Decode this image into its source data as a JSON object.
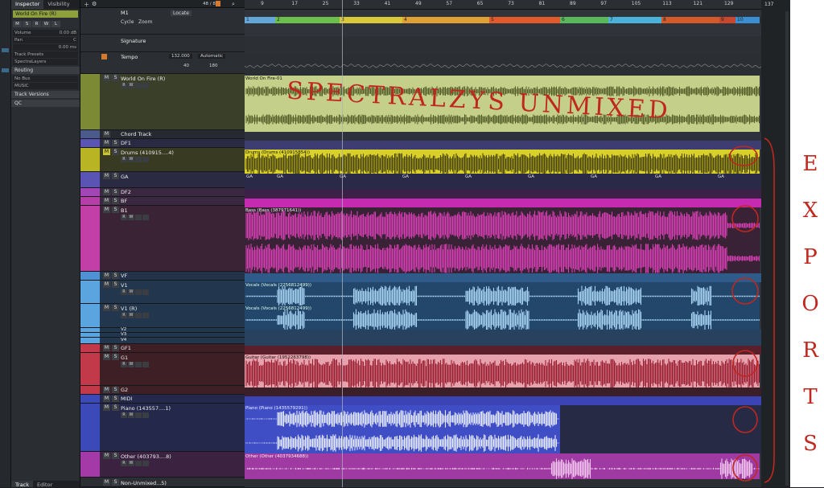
{
  "inspector": {
    "tabs": [
      "Inspector",
      "Visibility"
    ],
    "track_title": "World On Fire (R)",
    "buttons": [
      "M",
      "S",
      "R",
      "W",
      "L"
    ],
    "volume_label": "Volume",
    "volume_value": "0.00 dB",
    "pan_label": "Pan",
    "pan_value": "C",
    "delay_value": "0.00 ms",
    "preset": "Track Presets",
    "spectralayers": "SpectraLayers",
    "routing_label": "Routing",
    "routing_in": "No Bus",
    "routing_out": "MUSIC",
    "track_versions": "Track Versions",
    "qc": "QC",
    "bottom_tabs": [
      "Track",
      "Editor"
    ]
  },
  "tracklist_header": {
    "counter": "48 / 84"
  },
  "tracks": [
    {
      "name": "M1",
      "locate": "Locate",
      "cycle": "Cycle",
      "zoom": "Zoom"
    },
    {
      "name": "Signature"
    },
    {
      "name": "Tempo",
      "tempo_value": "132.000",
      "mode": "Automatic",
      "val1": "40",
      "val2": "180"
    },
    {
      "name": "World On Fire (R)"
    },
    {
      "name": "Chord Track"
    },
    {
      "name": "DF1"
    },
    {
      "name": "Drums (410915....4)"
    },
    {
      "name": "GA"
    },
    {
      "name": "DF2"
    },
    {
      "name": "BF"
    },
    {
      "name": "B1"
    },
    {
      "name": "VF"
    },
    {
      "name": "V1"
    },
    {
      "name": "V1 (R)"
    },
    {
      "name": "V2"
    },
    {
      "name": "V3"
    },
    {
      "name": "V4"
    },
    {
      "name": "GF1"
    },
    {
      "name": "G1"
    },
    {
      "name": "G2"
    },
    {
      "name": "MIDI"
    },
    {
      "name": "Piano (143557....1)"
    },
    {
      "name": "Other (403793....8)"
    },
    {
      "name": "Non-Unmixed...5)"
    }
  ],
  "ruler": {
    "ticks": [
      "9",
      "17",
      "25",
      "33",
      "41",
      "49",
      "57",
      "65",
      "73",
      "81",
      "89",
      "97",
      "105",
      "113",
      "121",
      "129"
    ],
    "position": "137"
  },
  "markers": [
    "1",
    "2",
    "3",
    "4",
    "5",
    "6",
    "7",
    "8",
    "9",
    "10"
  ],
  "clips": {
    "world": "World On Fire-01",
    "drums": "Drums (Drums (410915854))",
    "ga": "GA",
    "bass": "Bass (Bass (387971641))",
    "vocals1": "Vocals (Vocals (2256812499))",
    "vocals2": "Vocals (Vocals (2256812499))",
    "guitar": "Guitar (Guitar (1952263798))",
    "piano": "Piano (Piano (1435579291))",
    "other": "Other (Other (4037934688))"
  },
  "annotations": {
    "spectral": "SPECTRALZYS UNMIXED",
    "exports": [
      "E",
      "X",
      "P",
      "O",
      "R",
      "T",
      "S"
    ]
  },
  "colors": {
    "world": "#c4cf8a",
    "drums": "#d9d12a",
    "bass": "#d63fb2",
    "vocals": "#8fc1e8",
    "guitar": "#e6a2ad",
    "piano": "#3f4ec5",
    "other": "#c04ab8",
    "annotation": "#c0271f"
  }
}
